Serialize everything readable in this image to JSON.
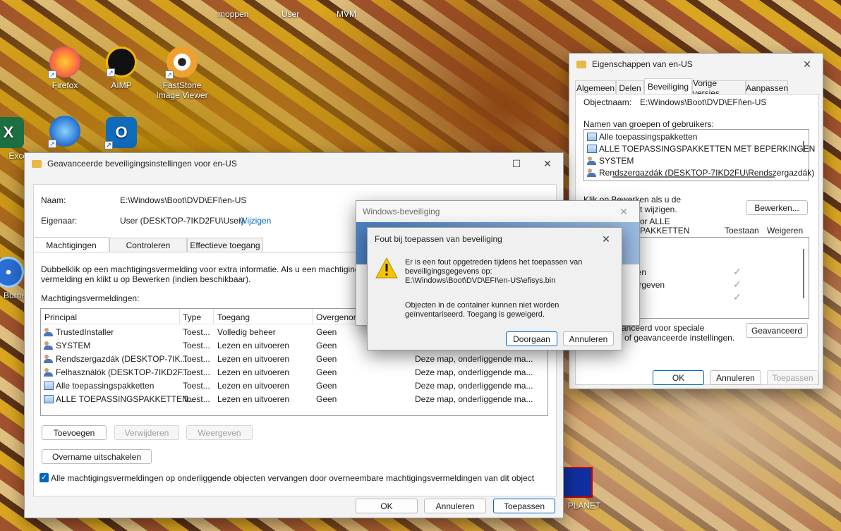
{
  "desktop": {
    "top_labels": [
      "moppen",
      "User",
      "MVM"
    ],
    "icons": [
      {
        "label": "Firefox",
        "color": "#ff7139"
      },
      {
        "label": "AIMP",
        "color": "#f5b800"
      },
      {
        "label": "FastStone Image Viewer",
        "color": "#f0a030"
      },
      {
        "label": "Excel",
        "color": "#1d6f42"
      },
      {
        "label": "Thunderbird",
        "color": "#1f6fd0"
      },
      {
        "label": "Outlook",
        "color": "#0f6cbd"
      },
      {
        "label": "BurnerX",
        "color": "#2a6fd6"
      },
      {
        "label": "PLANET",
        "color": "#1030a0"
      }
    ]
  },
  "advanced": {
    "title": "Geavanceerde beveiligingsinstellingen voor en-US",
    "name_label": "Naam:",
    "name_value": "E:\\Windows\\Boot\\DVD\\EFI\\en-US",
    "owner_label": "Eigenaar:",
    "owner_value": "User (DESKTOP-7IKD2FU\\User)",
    "change_link": "Wijzigen",
    "tabs": [
      "Machtigingen",
      "Controleren",
      "Effectieve toegang"
    ],
    "info_line1": "Dubbelklik op een machtigingsvermelding voor extra informatie. Als u een machtiging",
    "info_line2": "vermelding en klikt u op Bewerken (indien beschikbaar).",
    "entries_label": "Machtigingsvermeldingen:",
    "columns": [
      "Principal",
      "Type",
      "Toegang",
      "Overgenomen"
    ],
    "rows": [
      {
        "principal": "TrustedInstaller",
        "type": "Toest...",
        "access": "Volledig beheer",
        "inherited": "Geen",
        "applies": "",
        "icon": "user"
      },
      {
        "principal": "SYSTEM",
        "type": "Toest...",
        "access": "Lezen en uitvoeren",
        "inherited": "Geen",
        "applies": "",
        "icon": "user"
      },
      {
        "principal": "Rendszergazdák (DESKTOP-7IK...",
        "type": "Toest...",
        "access": "Lezen en uitvoeren",
        "inherited": "Geen",
        "applies": "Deze map, onderliggende ma...",
        "icon": "user"
      },
      {
        "principal": "Felhasználók (DESKTOP-7IKD2F...",
        "type": "Toest...",
        "access": "Lezen en uitvoeren",
        "inherited": "Geen",
        "applies": "Deze map, onderliggende ma...",
        "icon": "user"
      },
      {
        "principal": "Alle toepassingspakketten",
        "type": "Toest...",
        "access": "Lezen en uitvoeren",
        "inherited": "Geen",
        "applies": "Deze map, onderliggende ma...",
        "icon": "pkg"
      },
      {
        "principal": "ALLE TOEPASSINGSPAKKETTEN...",
        "type": "Toest...",
        "access": "Lezen en uitvoeren",
        "inherited": "Geen",
        "applies": "Deze map, onderliggende ma...",
        "icon": "pkg"
      }
    ],
    "add_button": "Toevoegen",
    "remove_button": "Verwijderen",
    "view_button": "Weergeven",
    "disable_inheritance": "Overname uitschakelen",
    "replace_checkbox": "Alle machtigingsvermeldingen op onderliggende objecten vervangen door overneembare machtigingsvermeldingen van dit object",
    "ok": "OK",
    "cancel": "Annuleren",
    "apply": "Toepassen"
  },
  "properties": {
    "title": "Eigenschappen van en-US",
    "tabs": [
      "Algemeen",
      "Delen",
      "Beveiliging",
      "Vorige versies",
      "Aanpassen"
    ],
    "object_label": "Objectnaam:",
    "object_value": "E:\\Windows\\Boot\\DVD\\EFI\\en-US",
    "groups_label": "Namen van groepen of gebruikers:",
    "groups": [
      {
        "name": "Alle toepassingspakketten",
        "icon": "pkg"
      },
      {
        "name": "ALLE TOEPASSINGSPAKKETTEN MET BEPERKINGEN",
        "icon": "pkg"
      },
      {
        "name": "SYSTEM",
        "icon": "user"
      },
      {
        "name": "Rendszergazdák (DESKTOP-7IKD2FU\\Rendszergazdák)",
        "icon": "user"
      }
    ],
    "edit_hint1": "Klik op Bewerken als u de",
    "edit_hint2": "t wijzigen.",
    "edit_button": "Bewerken...",
    "perm_for1": "or ALLE",
    "perm_for2": "PAKKETTEN",
    "allow_header": "Toestaan",
    "deny_header": "Weigeren",
    "perm_row_partial": [
      "er",
      "eren",
      "eergeven"
    ],
    "special_hint1": "vanceerd voor speciale",
    "special_hint2": "n of geavanceerde instellingen.",
    "advanced_button": "Geavanceerd",
    "ok": "OK",
    "cancel": "Annuleren",
    "apply": "Toepassen"
  },
  "winsec": {
    "title": "Windows-beveiliging"
  },
  "error": {
    "title": "Fout bij toepassen van beveiliging",
    "msg1": "Er is een fout opgetreden tijdens het toepassen van",
    "msg2": "beveiligingsgegevens op:",
    "msg3": "E:\\Windows\\Boot\\DVD\\EFI\\en-US\\efisys.bin",
    "msg4": "Objecten in de container kunnen niet worden",
    "msg5": "geïnventariseerd. Toegang is geweigerd.",
    "continue_button": "Doorgaan",
    "cancel_button": "Annuleren"
  }
}
